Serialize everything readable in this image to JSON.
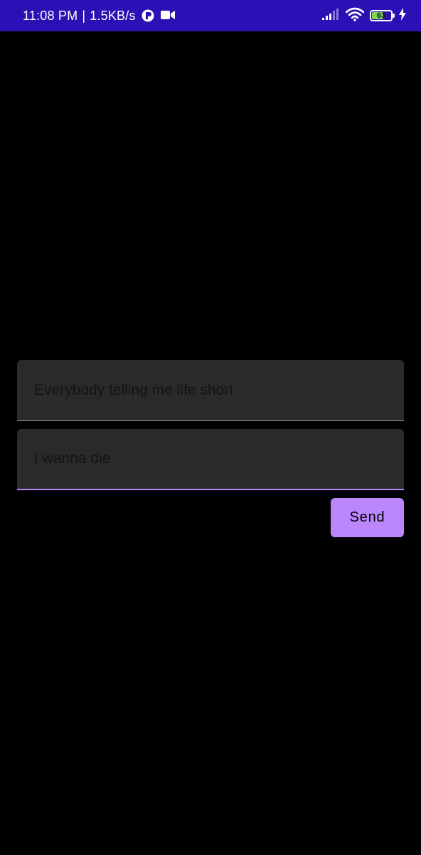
{
  "status_bar": {
    "time": "11:08 PM",
    "separator": "|",
    "network_speed": "1.5KB/s",
    "battery_level": "63",
    "battery_fraction": 0.63,
    "icons": [
      "app-notification-icon",
      "video-camera-icon",
      "signal-strength-icon",
      "wifi-icon",
      "battery-icon",
      "charging-bolt-icon"
    ],
    "background_color": "#2d10b5",
    "battery_color": "#7ed957"
  },
  "form": {
    "field_1": {
      "value": "Everybody telling me life short"
    },
    "field_2": {
      "value": "I wanna die"
    },
    "send_label": "Send",
    "accent_color": "#bb86fc"
  }
}
